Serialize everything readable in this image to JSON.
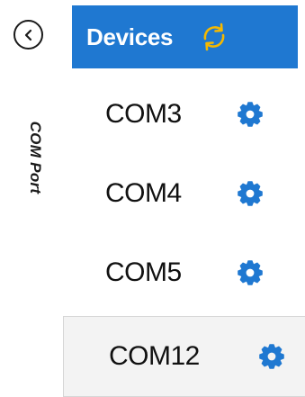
{
  "back": {
    "icon": "back-arrow-icon"
  },
  "sidebar": {
    "label": "COM Port"
  },
  "header": {
    "title": "Devices",
    "refresh_icon": "refresh-icon",
    "background": "#1f78d1",
    "refresh_color": "#f5b800"
  },
  "devices": [
    {
      "name": "COM3",
      "icon": "gear-icon",
      "selected": false
    },
    {
      "name": "COM4",
      "icon": "gear-icon",
      "selected": false
    },
    {
      "name": "COM5",
      "icon": "gear-icon",
      "selected": false
    },
    {
      "name": "COM12",
      "icon": "gear-icon",
      "selected": true
    }
  ],
  "colors": {
    "gear": "#1f78d1",
    "selected_bg": "#f3f3f3"
  }
}
